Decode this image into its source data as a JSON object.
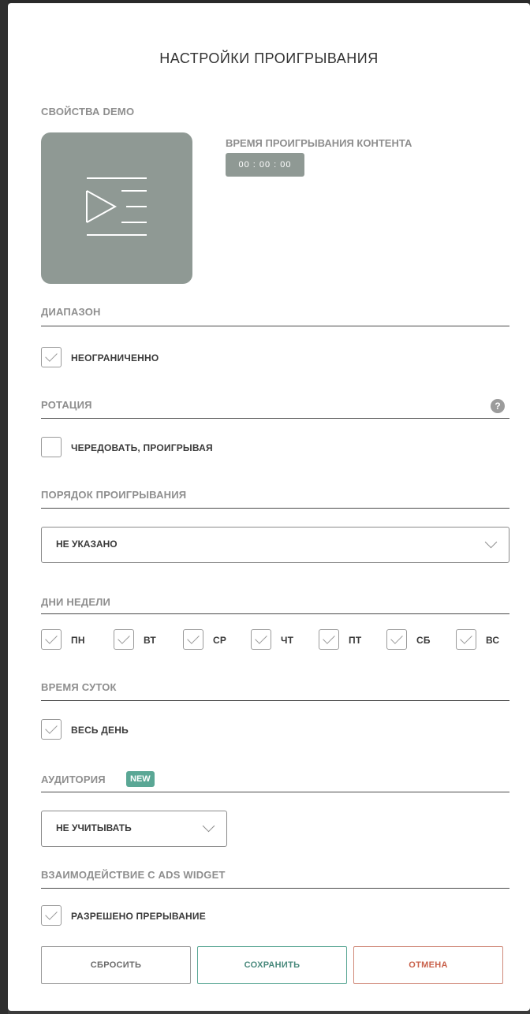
{
  "dialog": {
    "title": "НАСТРОЙКИ ПРОИГРЫВАНИЯ"
  },
  "demo": {
    "section_label": "СВОЙСТВА DEMO",
    "thumbnail_icon": "playlist-play-icon",
    "duration_label": "ВРЕМЯ ПРОИГРЫВАНИЯ КОНТЕНТА",
    "duration_value": "00 : 00 : 00"
  },
  "range": {
    "section_label": "ДИАПАЗОН",
    "unlimited_label": "НЕОГРАНИЧЕННО",
    "unlimited_checked": true
  },
  "rotation": {
    "section_label": "РОТАЦИЯ",
    "help_icon": "?",
    "alternate_label": "ЧЕРЕДОВАТЬ, ПРОИГРЫВАЯ",
    "alternate_checked": false
  },
  "play_order": {
    "section_label": "ПОРЯДОК ПРОИГРЫВАНИЯ",
    "selected": "НЕ УКАЗАНО"
  },
  "weekdays": {
    "section_label": "ДНИ НЕДЕЛИ",
    "days": [
      {
        "label": "ПН",
        "checked": true
      },
      {
        "label": "ВТ",
        "checked": true
      },
      {
        "label": "СР",
        "checked": true
      },
      {
        "label": "ЧТ",
        "checked": true
      },
      {
        "label": "ПТ",
        "checked": true
      },
      {
        "label": "СБ",
        "checked": true
      },
      {
        "label": "ВС",
        "checked": true
      }
    ]
  },
  "time_of_day": {
    "section_label": "ВРЕМЯ СУТОК",
    "all_day_label": "ВЕСЬ ДЕНЬ",
    "all_day_checked": true
  },
  "audience": {
    "section_label": "АУДИТОРИЯ",
    "badge": "NEW",
    "selected": "НЕ УЧИТЫВАТЬ"
  },
  "ads_widget": {
    "section_label": "ВЗАИМОДЕЙСТВИЕ С ADS WIDGET",
    "interrupt_label": "РАЗРЕШЕНО ПРЕРЫВАНИЕ",
    "interrupt_checked": true
  },
  "buttons": {
    "reset": "СБРОСИТЬ",
    "save": "СОХРАНИТЬ",
    "cancel": "ОТМЕНА"
  },
  "colors": {
    "accent_green": "#5aa795",
    "cancel_red": "#c9624c",
    "thumbnail_gray": "#8f9994"
  }
}
